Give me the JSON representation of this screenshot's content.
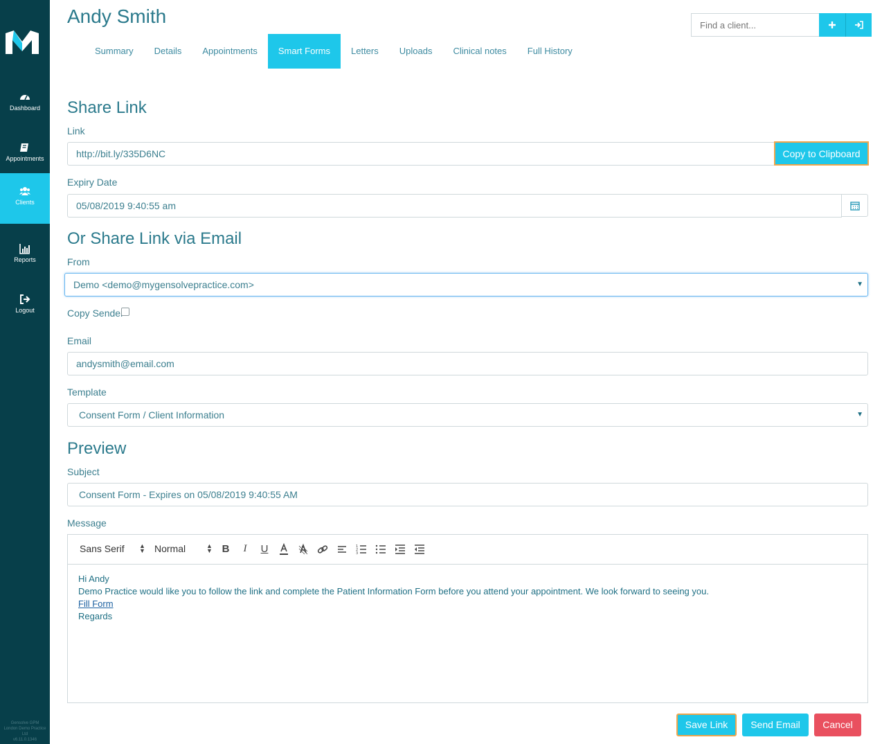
{
  "sidebar": {
    "items": [
      {
        "label": "Dashboard",
        "icon": "dashboard-icon"
      },
      {
        "label": "Appointments",
        "icon": "book-icon"
      },
      {
        "label": "Clients",
        "icon": "users-icon",
        "active": true
      },
      {
        "label": "Reports",
        "icon": "bar-chart-icon"
      },
      {
        "label": "Logout",
        "icon": "logout-icon"
      }
    ],
    "version_lines": [
      "Gensolve GPM",
      "London Demo Practice",
      "Ltd",
      "v6.11.0.1346"
    ]
  },
  "header": {
    "client_name": "Andy Smith",
    "find_placeholder": "Find a client..."
  },
  "tabs": [
    "Summary",
    "Details",
    "Appointments",
    "Smart Forms",
    "Letters",
    "Uploads",
    "Clinical notes",
    "Full History"
  ],
  "active_tab": "Smart Forms",
  "share_link": {
    "title": "Share Link",
    "link_label": "Link",
    "link_value": "http://bit.ly/335D6NC",
    "copy_button": "Copy to Clipboard",
    "expiry_label": "Expiry Date",
    "expiry_value": "05/08/2019 9:40:55 am"
  },
  "email_share": {
    "title": "Or Share Link via Email",
    "from_label": "From",
    "from_value": "Demo <demo@mygensolvepractice.com>",
    "copy_sender_label": "Copy Sender",
    "copy_sender_checked": false,
    "email_label": "Email",
    "email_value": "andysmith@email.com",
    "template_label": "Template",
    "template_value": "Consent Form / Client Information"
  },
  "preview": {
    "title": "Preview",
    "subject_label": "Subject",
    "subject_value": "Consent Form - Expires on 05/08/2019 9:40:55 AM",
    "message_label": "Message",
    "toolbar": {
      "font": "Sans Serif",
      "size": "Normal"
    },
    "message": {
      "greeting": "Hi Andy",
      "body": "Demo Practice would like you to follow the link and complete the Patient Information Form before you attend your appointment. We look forward to seeing you.",
      "link_text": "Fill Form",
      "closing": "Regards"
    }
  },
  "actions": {
    "save_link": "Save Link",
    "send_email": "Send Email",
    "cancel": "Cancel"
  },
  "colors": {
    "sidebar": "#073f4a",
    "accent": "#1ec7ea",
    "highlight": "#f0a54a",
    "danger": "#e9505f",
    "text": "#2b7a8c"
  }
}
